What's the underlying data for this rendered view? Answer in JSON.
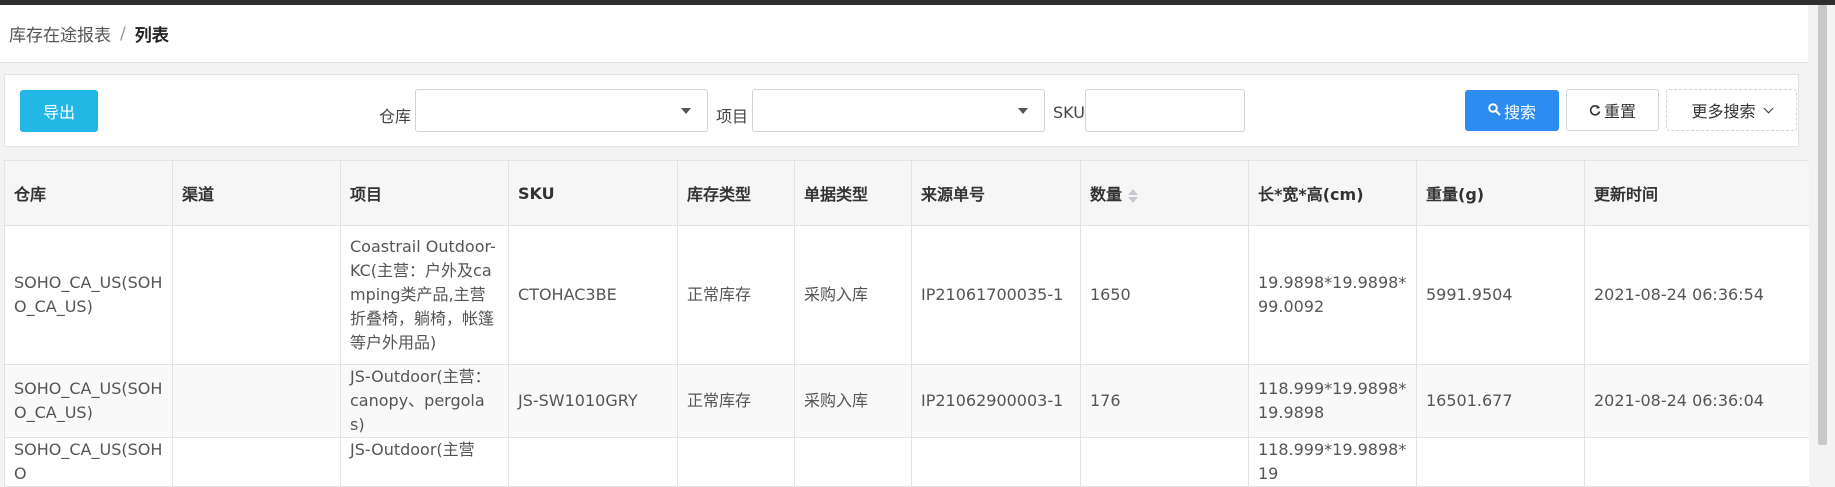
{
  "breadcrumb": {
    "parent": "库存在途报表",
    "separator": "/",
    "current": "列表"
  },
  "toolbar": {
    "export_label": "导出",
    "warehouse_label": "仓库",
    "warehouse_value": "",
    "project_label": "项目",
    "project_value": "",
    "sku_label": "SKU",
    "sku_value": "",
    "search_label": "搜索",
    "reset_label": "重置",
    "more_search_label": "更多搜索"
  },
  "table": {
    "columns": [
      "仓库",
      "渠道",
      "项目",
      "SKU",
      "库存类型",
      "单据类型",
      "来源单号",
      "数量",
      "长*宽*高(cm)",
      "重量(g)",
      "更新时间"
    ],
    "rows": [
      [
        "SOHO_CA_US(SOHO_CA_US)",
        "",
        "Coastrail Outdoor-KC(主营：户外及camping类产品,主营折叠椅，躺椅，帐篷等户外用品)",
        "CTOHAC3BE",
        "正常库存",
        "采购入库",
        "IP21061700035-1",
        "1650",
        "19.9898*19.9898*99.0092",
        "5991.9504",
        "2021-08-24 06:36:54"
      ],
      [
        "SOHO_CA_US(SOHO_CA_US)",
        "",
        "JS-Outdoor(主营：canopy、pergolas)",
        "JS-SW1010GRY",
        "正常库存",
        "采购入库",
        "IP21062900003-1",
        "176",
        "118.999*19.9898*19.9898",
        "16501.677",
        "2021-08-24 06:36:04"
      ],
      [
        "SOHO_CA_US(SOHO",
        "",
        "JS-Outdoor(主营",
        "",
        "",
        "",
        "",
        "",
        "118.999*19.9898*19",
        "",
        ""
      ]
    ]
  },
  "colors": {
    "accent_blue": "#2d8cf0",
    "export_cyan": "#23b7e5",
    "top_bar": "#2f2f2f"
  },
  "icons": {
    "search": "search-icon",
    "reset": "refresh-icon",
    "more": "chevron-down-icon",
    "sort": "sort-icon",
    "dropdown": "caret-down-icon"
  }
}
